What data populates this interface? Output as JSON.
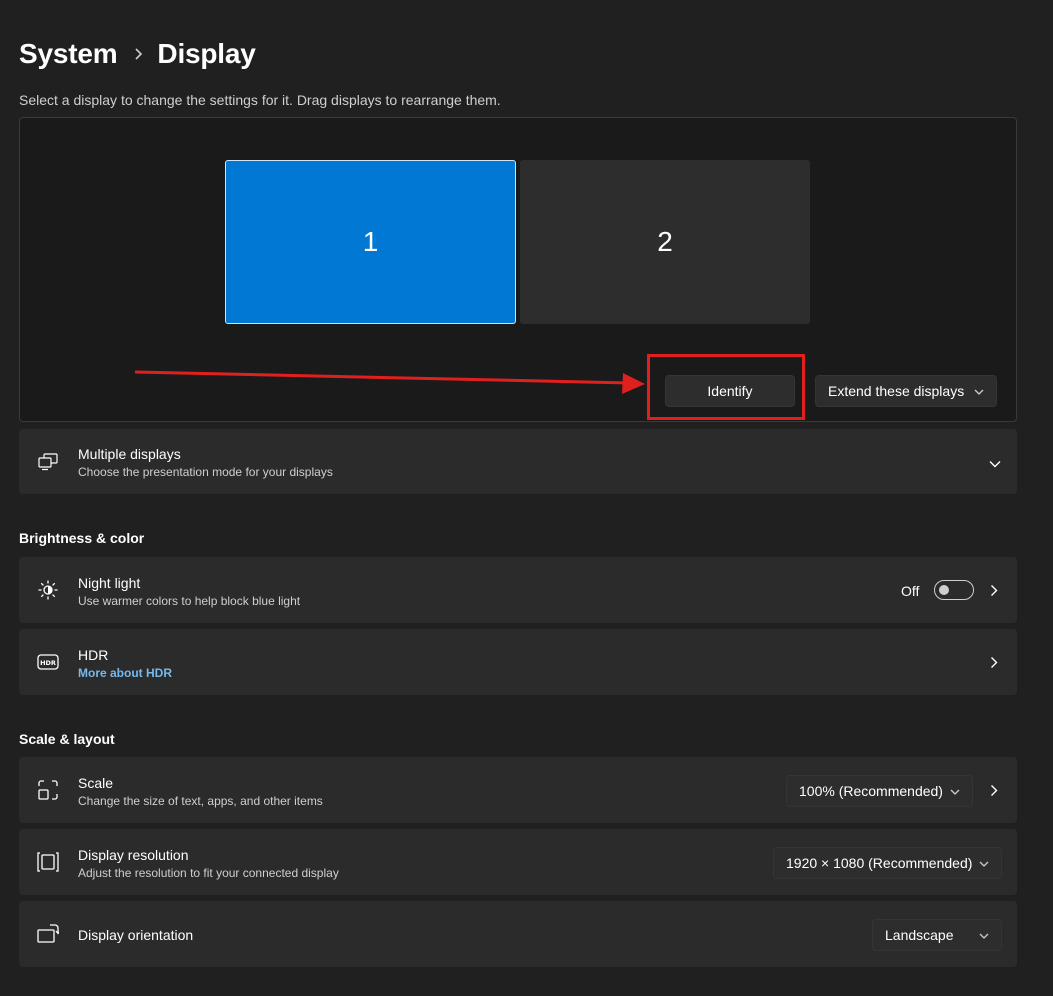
{
  "breadcrumb": {
    "parent": "System",
    "current": "Display"
  },
  "arrangement": {
    "instruction": "Select a display to change the settings for it. Drag displays to rearrange them.",
    "monitors": [
      {
        "label": "1",
        "selected": true
      },
      {
        "label": "2",
        "selected": false
      }
    ],
    "identify_label": "Identify",
    "mode_value": "Extend these displays"
  },
  "multiple_displays": {
    "title": "Multiple displays",
    "description": "Choose the presentation mode for your displays",
    "icon": "multiple-displays-icon"
  },
  "brightness_section": {
    "title": "Brightness & color",
    "night_light": {
      "title": "Night light",
      "description": "Use warmer colors to help block blue light",
      "state_label": "Off",
      "enabled": false,
      "icon": "brightness-icon"
    },
    "hdr": {
      "title": "HDR",
      "link": "More about HDR",
      "icon": "hdr-icon"
    }
  },
  "scale_section": {
    "title": "Scale & layout",
    "scale": {
      "title": "Scale",
      "description": "Change the size of text, apps, and other items",
      "value": "100% (Recommended)",
      "icon": "scale-icon"
    },
    "resolution": {
      "title": "Display resolution",
      "description": "Adjust the resolution to fit your connected display",
      "value": "1920 × 1080 (Recommended)",
      "icon": "resolution-icon"
    },
    "orientation": {
      "title": "Display orientation",
      "value": "Landscape",
      "icon": "orientation-icon"
    }
  },
  "colors": {
    "accent": "#0078d4",
    "link": "#76b9ed",
    "highlight": "#e0201e",
    "background": "#202020",
    "card": "#2b2b2b"
  }
}
